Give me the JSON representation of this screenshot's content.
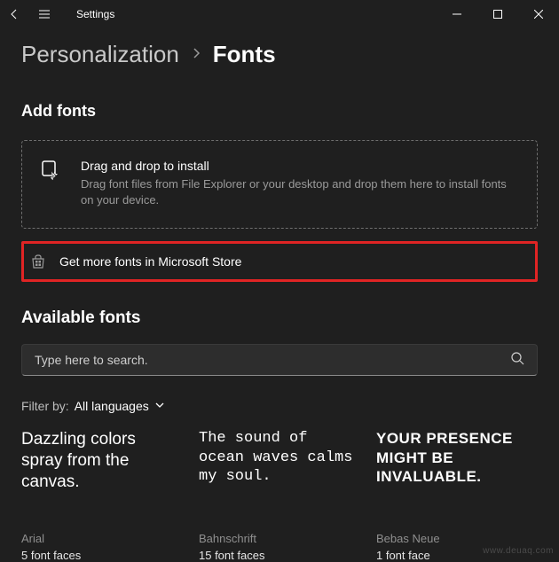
{
  "titlebar": {
    "app_name": "Settings"
  },
  "breadcrumb": {
    "parent": "Personalization",
    "current": "Fonts"
  },
  "sections": {
    "add_fonts_heading": "Add fonts",
    "available_fonts_heading": "Available fonts"
  },
  "dropzone": {
    "title": "Drag and drop to install",
    "subtitle": "Drag font files from File Explorer or your desktop and drop them here to install fonts on your device."
  },
  "store_link": {
    "label": "Get more fonts in Microsoft Store"
  },
  "search": {
    "placeholder": "Type here to search."
  },
  "filter": {
    "label": "Filter by:",
    "value": "All languages"
  },
  "fonts": [
    {
      "sample": "Dazzling colors spray from the canvas.",
      "name": "Arial",
      "faces": "5 font faces"
    },
    {
      "sample": "The sound of ocean waves calms my soul.",
      "name": "Bahnschrift",
      "faces": "15 font faces"
    },
    {
      "sample": "Your presence might be invaluable.",
      "name": "Bebas Neue",
      "faces": "1 font face"
    }
  ],
  "watermark": "www.deuaq.com"
}
